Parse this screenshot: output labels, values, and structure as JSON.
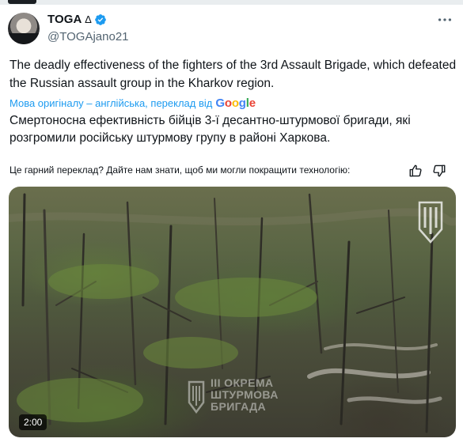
{
  "author": {
    "display_name": "TOGA",
    "name_badge": "∆",
    "handle": "@TOGAjano21",
    "verified": true
  },
  "tweet": {
    "text": "The deadly effectiveness of the fighters of the 3rd Assault Brigade, which defeated the Russian assault group in the Kharkov region."
  },
  "translation": {
    "source_label": "Мова оригіналу – англійська, переклад від",
    "provider": {
      "G": "G",
      "o1": "o",
      "o2": "o",
      "g": "g",
      "l": "l",
      "e": "e"
    },
    "translated_text": "Смертоносна ефективність бійців 3-ї десантно-штурмової бригади, які розгромили російську штурмову групу в районі Харкова.",
    "feedback_prompt": "Це гарний переклад? Дайте нам знати, щоб ми могли покращити технологію:"
  },
  "media": {
    "timestamp": "2:00",
    "watermark_lines": [
      "ІІІ ОКРЕМА",
      "ШТУРМОВА",
      "БРИГАДА"
    ]
  },
  "colors": {
    "accent": "#1d9bf0",
    "text_primary": "#0f1419",
    "text_secondary": "#536471"
  },
  "icons": {
    "verified": "verified-badge-icon",
    "more": "more-options-icon",
    "thumb_up": "thumbs-up-icon",
    "thumb_down": "thumbs-down-icon",
    "brigade_logo": "brigade-emblem-icon"
  }
}
